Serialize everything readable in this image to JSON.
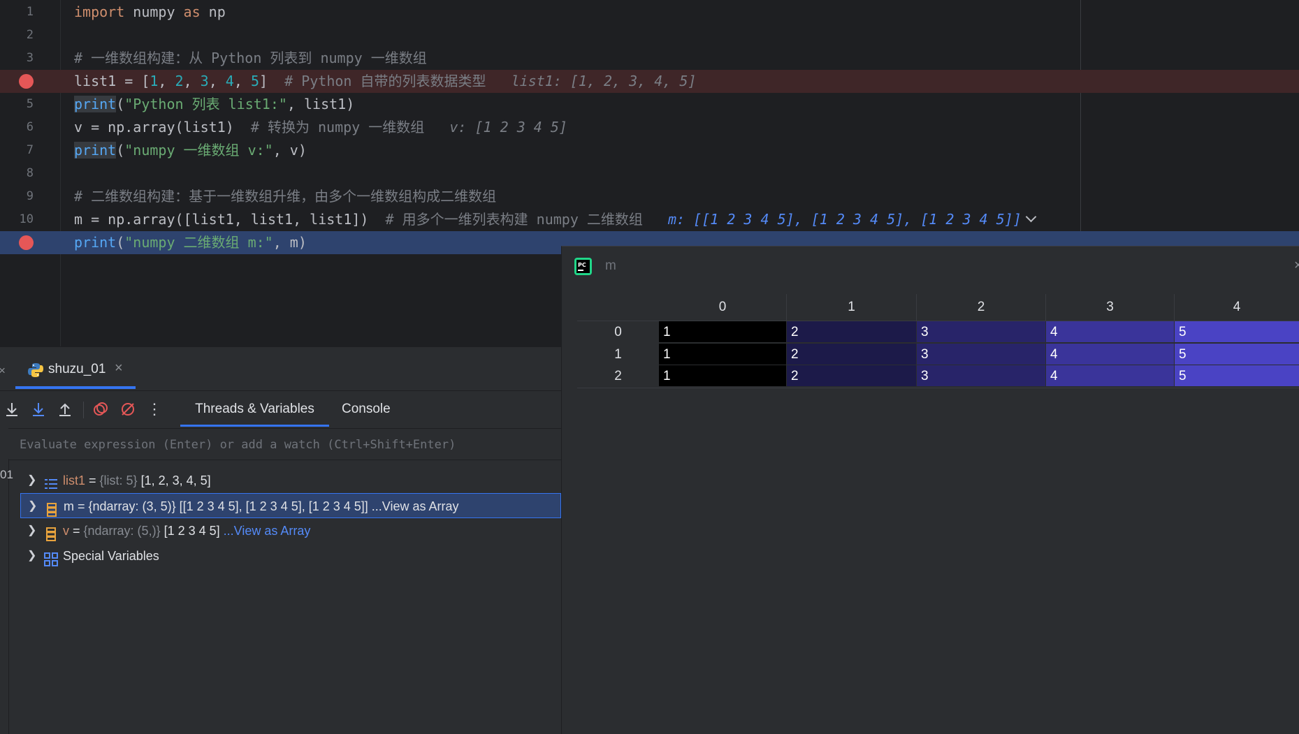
{
  "editor": {
    "lines": [
      {
        "num": "1",
        "parts": [
          {
            "t": "import",
            "c": "kw"
          },
          {
            "t": " numpy ",
            "c": ""
          },
          {
            "t": "as",
            "c": "kw"
          },
          {
            "t": " np",
            "c": ""
          }
        ]
      },
      {
        "num": "2",
        "parts": []
      },
      {
        "num": "3",
        "parts": [
          {
            "t": "# 一维数组构建：从 Python 列表到 numpy 一维数组",
            "c": "cm"
          }
        ]
      },
      {
        "num": "",
        "breakpoint": true,
        "style": "bp-line",
        "parts": [
          {
            "t": "list1 = [",
            "c": ""
          },
          {
            "t": "1",
            "c": "num"
          },
          {
            "t": ", ",
            "c": ""
          },
          {
            "t": "2",
            "c": "num"
          },
          {
            "t": ", ",
            "c": ""
          },
          {
            "t": "3",
            "c": "num"
          },
          {
            "t": ", ",
            "c": ""
          },
          {
            "t": "4",
            "c": "num"
          },
          {
            "t": ", ",
            "c": ""
          },
          {
            "t": "5",
            "c": "num"
          },
          {
            "t": "]  ",
            "c": ""
          },
          {
            "t": "# Python 自带的列表数据类型",
            "c": "cm"
          },
          {
            "t": "   list1: [1, 2, 3, 4, 5]",
            "c": "hint"
          }
        ]
      },
      {
        "num": "5",
        "parts": [
          {
            "t": "print",
            "c": "fn-hl"
          },
          {
            "t": "(",
            "c": ""
          },
          {
            "t": "\"Python 列表 list1:\"",
            "c": "str"
          },
          {
            "t": ", list1)",
            "c": ""
          }
        ]
      },
      {
        "num": "6",
        "parts": [
          {
            "t": "v = np.array(list1)  ",
            "c": ""
          },
          {
            "t": "# 转换为 numpy 一维数组",
            "c": "cm"
          },
          {
            "t": "   v: [1 2 3 4 5]",
            "c": "hint"
          }
        ]
      },
      {
        "num": "7",
        "parts": [
          {
            "t": "print",
            "c": "fn-hl"
          },
          {
            "t": "(",
            "c": ""
          },
          {
            "t": "\"numpy 一维数组 v:\"",
            "c": "str"
          },
          {
            "t": ", v)",
            "c": ""
          }
        ]
      },
      {
        "num": "8",
        "parts": []
      },
      {
        "num": "9",
        "parts": [
          {
            "t": "# 二维数组构建：基于一维数组升维，由多个一维数组构成二维数组",
            "c": "cm"
          }
        ]
      },
      {
        "num": "10",
        "chevron": true,
        "parts": [
          {
            "t": "m = np.array([list1, list1, list1])  ",
            "c": ""
          },
          {
            "t": "# 用多个一维列表构建 numpy 二维数组",
            "c": "cm"
          },
          {
            "t": "   m: [[1 2 3 4 5], [1 2 3 4 5], [1 2 3 4 5]]",
            "c": "hint-blue"
          }
        ]
      },
      {
        "num": "",
        "breakpoint": true,
        "style": "exec-line",
        "parts": [
          {
            "t": "print",
            "c": "fn"
          },
          {
            "t": "(",
            "c": ""
          },
          {
            "t": "\"numpy 二维数组 m:\"",
            "c": "str"
          },
          {
            "t": ", m)",
            "c": ""
          }
        ]
      }
    ]
  },
  "debug": {
    "run_tab": "shuzu_01",
    "tabs": [
      "Threads & Variables",
      "Console"
    ],
    "eval_placeholder": "Evaluate expression (Enter) or add a watch (Ctrl+Shift+Enter)",
    "frame_stub": "01",
    "variables": [
      {
        "name": "list1",
        "eq": " = ",
        "type": "{list: 5}",
        "value": " [1, 2, 3, 4, 5]",
        "link": "",
        "icon": "list-icon"
      },
      {
        "name": "m",
        "eq": " = ",
        "type": "{ndarray: (3, 5)}",
        "value": " [[1 2 3 4 5], [1 2 3 4 5], [1 2 3 4 5]] ",
        "link": "...View as Array",
        "icon": "ndarray-icon",
        "selected": true
      },
      {
        "name": "v",
        "eq": " = ",
        "type": "{ndarray: (5,)}",
        "value": " [1 2 3 4 5] ",
        "link": "...View as Array",
        "icon": "ndarray-icon"
      },
      {
        "name": "Special Variables",
        "eq": "",
        "type": "",
        "value": "",
        "link": "",
        "icon": "special-variables-icon"
      }
    ]
  },
  "viewer": {
    "title": "m",
    "columns": [
      "0",
      "1",
      "2",
      "3",
      "4"
    ],
    "rows": [
      "0",
      "1",
      "2"
    ],
    "cells": [
      [
        "1",
        "2",
        "3",
        "4",
        "5"
      ],
      [
        "1",
        "2",
        "3",
        "4",
        "5"
      ],
      [
        "1",
        "2",
        "3",
        "4",
        "5"
      ]
    ],
    "heat_colors": [
      "#000000",
      "#1c1a49",
      "#282469",
      "#3a349a",
      "#4a43c4"
    ]
  }
}
